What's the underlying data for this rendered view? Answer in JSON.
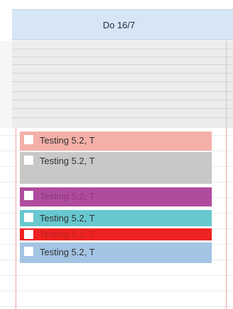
{
  "header": {
    "day_label": "Do 16/7"
  },
  "events": [
    {
      "label": "Testing 5.2, T",
      "color": "#f4b0a8",
      "text_color": "#333333"
    },
    {
      "label": "Testing 5.2, T",
      "color": "#c8c8c6",
      "text_color": "#333333"
    },
    {
      "label": "Testing 5.2, T",
      "color": "#b04c9e",
      "text_color": "#8a3a80"
    },
    {
      "label": "Testing 5.2, T",
      "color": "#68c8d0",
      "text_color": "#333333"
    },
    {
      "label": "Testing 5.2, T",
      "color": "#ee2222",
      "text_color": "#c22020"
    },
    {
      "label": "Testing 5.2, T",
      "color": "#a4c4e4",
      "text_color": "#333333"
    }
  ]
}
